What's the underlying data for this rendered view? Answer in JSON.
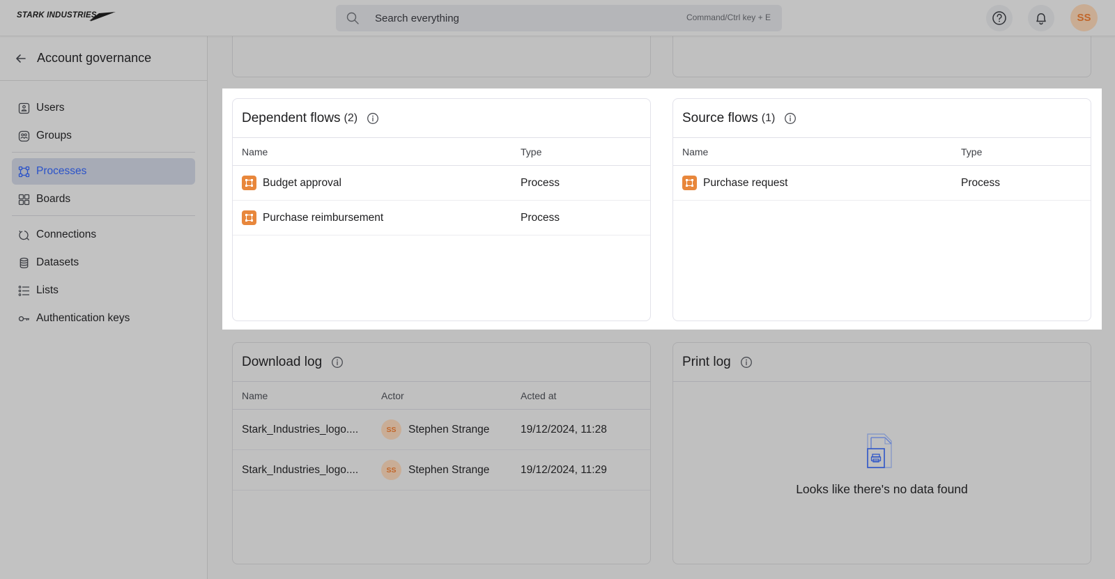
{
  "brand": {
    "logo_text": "STARK INDUSTRIES"
  },
  "topbar": {
    "search_placeholder": "Search everything",
    "search_hint": "Command/Ctrl key + E",
    "help_icon": "question-circle-icon",
    "notifications_icon": "bell-icon",
    "user_initials": "SS"
  },
  "sidebar": {
    "title": "Account governance",
    "back_icon": "arrow-left-icon",
    "groups": [
      [
        {
          "label": "Users",
          "icon": "user-badge-icon",
          "active": false
        },
        {
          "label": "Groups",
          "icon": "group-badge-icon",
          "active": false
        }
      ],
      [
        {
          "label": "Processes",
          "icon": "process-nodes-icon",
          "active": true
        },
        {
          "label": "Boards",
          "icon": "grid-icon",
          "active": false
        }
      ],
      [
        {
          "label": "Connections",
          "icon": "connection-icon",
          "active": false
        },
        {
          "label": "Datasets",
          "icon": "database-icon",
          "active": false
        },
        {
          "label": "Lists",
          "icon": "list-icon",
          "active": false
        },
        {
          "label": "Authentication keys",
          "icon": "key-icon",
          "active": false
        }
      ]
    ]
  },
  "dependent_flows": {
    "title": "Dependent flows",
    "count": "(2)",
    "columns": [
      "Name",
      "Type"
    ],
    "rows": [
      {
        "name": "Budget approval",
        "type": "Process"
      },
      {
        "name": "Purchase reimbursement",
        "type": "Process"
      }
    ]
  },
  "source_flows": {
    "title": "Source flows",
    "count": "(1)",
    "columns": [
      "Name",
      "Type"
    ],
    "rows": [
      {
        "name": "Purchase request",
        "type": "Process"
      }
    ]
  },
  "download_log": {
    "title": "Download log",
    "columns": [
      "Name",
      "Actor",
      "Acted at"
    ],
    "rows": [
      {
        "name": "Stark_Industries_logo....",
        "actor_initials": "SS",
        "actor": "Stephen Strange",
        "acted_at": "19/12/2024, 11:28"
      },
      {
        "name": "Stark_Industries_logo....",
        "actor_initials": "SS",
        "actor": "Stephen Strange",
        "acted_at": "19/12/2024, 11:29"
      }
    ]
  },
  "print_log": {
    "title": "Print log",
    "empty_text": "Looks like there's no data found",
    "empty_icon": "print-document-icon"
  },
  "colors": {
    "accent": "#2a52c9",
    "process_icon": "#e8873c",
    "avatar_text": "#c1662a"
  }
}
